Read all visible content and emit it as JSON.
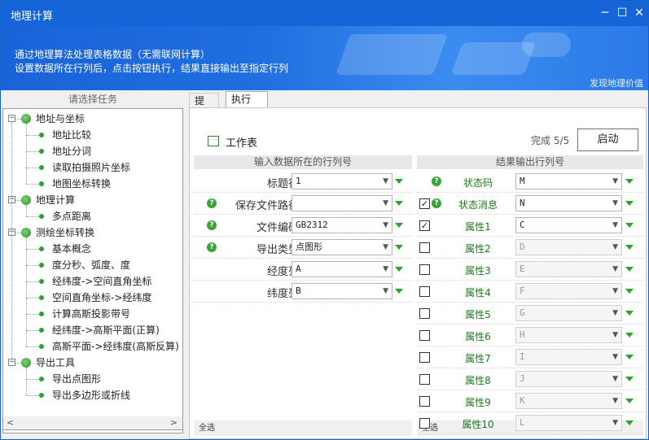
{
  "window": {
    "title": "地理计算",
    "minimize_label": "─",
    "maximize_label": "☐",
    "close_label": "✕"
  },
  "banner": {
    "line1": "通过地理算法处理表格数据（无需联网计算）",
    "line2": "设置数据所在行列后，点击按钮执行，结果直接输出至指定行列",
    "link": "发现地理价值"
  },
  "left": {
    "header": "请选择任务",
    "tree": [
      {
        "label": "地址与坐标",
        "level": 0,
        "expander": "−"
      },
      {
        "label": "地址比较",
        "level": 1
      },
      {
        "label": "地址分词",
        "level": 1
      },
      {
        "label": "读取拍摄照片坐标",
        "level": 1
      },
      {
        "label": "地图坐标转换",
        "level": 1
      },
      {
        "label": "地理计算",
        "level": 0,
        "expander": "−"
      },
      {
        "label": "多点距离",
        "level": 1
      },
      {
        "label": "测绘坐标转换",
        "level": 0,
        "expander": "−"
      },
      {
        "label": "基本概念",
        "level": 1
      },
      {
        "label": "度分秒、弧度、度",
        "level": 1
      },
      {
        "label": "经纬度->空间直角坐标",
        "level": 1
      },
      {
        "label": "空间直角坐标->经纬度",
        "level": 1
      },
      {
        "label": "计算高斯投影带号",
        "level": 1
      },
      {
        "label": "经纬度->高斯平面(正算)",
        "level": 1
      },
      {
        "label": "高斯平面->经纬度(高斯反算)",
        "level": 1
      },
      {
        "label": "导出工具",
        "level": 0,
        "expander": "−"
      },
      {
        "label": "导出点图形",
        "level": 1
      },
      {
        "label": "导出多边形或折线",
        "level": 1
      }
    ],
    "scroll_left": "<",
    "scroll_right": ">"
  },
  "tabs": [
    {
      "label": "提示"
    },
    {
      "label": "执行"
    }
  ],
  "toolbar": {
    "worksheet_label": "工作表",
    "progress": "完成 5/5",
    "start_label": "启动"
  },
  "input_section": {
    "header": "输入数据所在的行列号",
    "rows": [
      {
        "label": "标题行",
        "value": "1",
        "help": false
      },
      {
        "label": "保存文件路径",
        "value": "",
        "help": true
      },
      {
        "label": "文件编码",
        "value": "GB2312",
        "help": true
      },
      {
        "label": "导出类型",
        "value": "点图形",
        "help": true
      },
      {
        "label": "经度列",
        "value": "A",
        "help": false
      },
      {
        "label": "纬度列",
        "value": "B",
        "help": false
      }
    ],
    "select_all": "全选"
  },
  "output_section": {
    "header": "结果输出行列号",
    "rows": [
      {
        "label": "状态码",
        "value": "M",
        "checkbox": "none",
        "help": true
      },
      {
        "label": "状态消息",
        "value": "N",
        "checkbox": "checked",
        "help": true
      },
      {
        "label": "属性1",
        "value": "C",
        "checkbox": "checked",
        "help": false
      },
      {
        "label": "属性2",
        "value": "D",
        "checkbox": "unchecked",
        "help": false
      },
      {
        "label": "属性3",
        "value": "E",
        "checkbox": "unchecked",
        "help": false
      },
      {
        "label": "属性4",
        "value": "F",
        "checkbox": "unchecked",
        "help": false
      },
      {
        "label": "属性5",
        "value": "G",
        "checkbox": "unchecked",
        "help": false
      },
      {
        "label": "属性6",
        "value": "H",
        "checkbox": "unchecked",
        "help": false
      },
      {
        "label": "属性7",
        "value": "I",
        "checkbox": "unchecked",
        "help": false
      },
      {
        "label": "属性8",
        "value": "J",
        "checkbox": "unchecked",
        "help": false
      },
      {
        "label": "属性9",
        "value": "K",
        "checkbox": "unchecked",
        "help": false
      },
      {
        "label": "属性10",
        "value": "L",
        "checkbox": "unchecked",
        "help": false
      }
    ],
    "select_all": "全选"
  },
  "colors": {
    "titlebar": "#1565d8",
    "accent_green": "#2aa52a",
    "label_green": "#1b7a1b"
  }
}
